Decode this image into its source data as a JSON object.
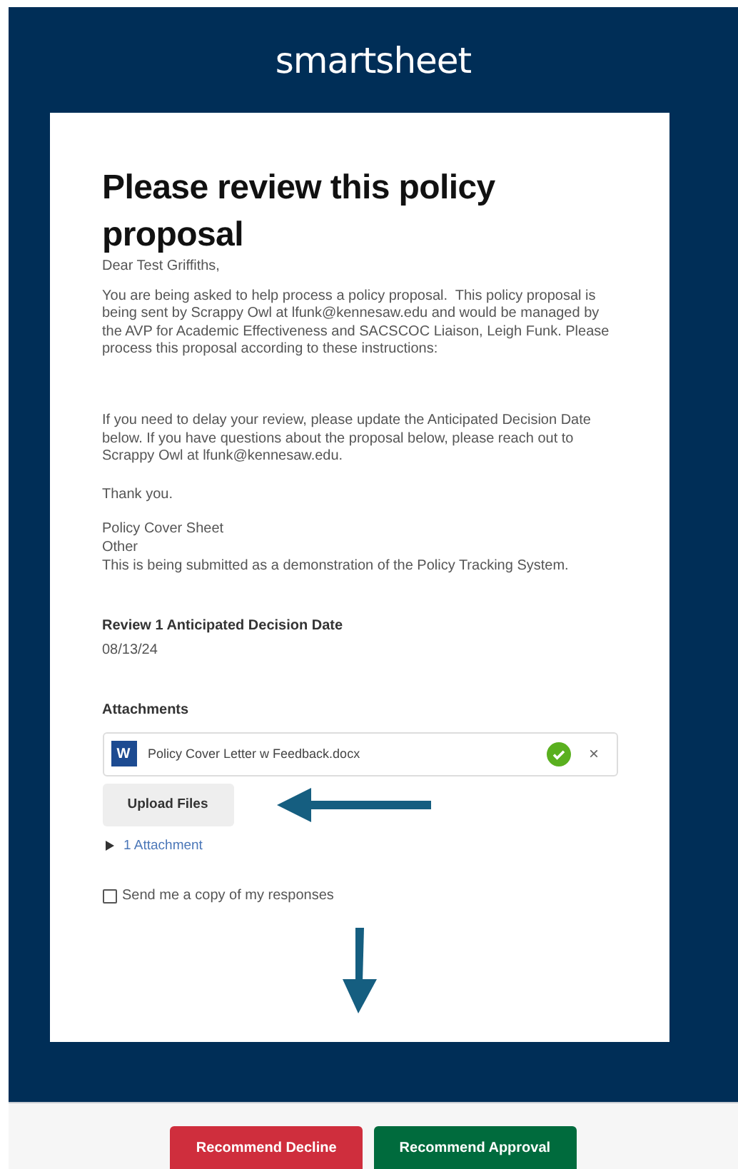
{
  "logo": "smartsheet",
  "title": "Please review this policy proposal",
  "greeting": "Dear Test Griffiths,",
  "paragraphs": [
    {
      "lines": [
        "You are being asked to help process a policy proposal.  This policy proposal is being sent by Scrappy Owl at lfunk@kennesaw.edu and would be managed by the AVP for Academic Effectiveness and SACSCOC Liaison, Leigh Funk. Please process this proposal according to these instructions:"
      ]
    },
    {
      "lines": [
        "If you need to delay your review, please update the Anticipated Decision Date below. If you have questions about the proposal below, please reach out to Scrappy Owl at lfunk@kennesaw.edu."
      ]
    },
    {
      "lines": [
        "Thank you."
      ]
    },
    {
      "lines": [
        "Policy Cover Sheet",
        "Other",
        "This is being submitted as a demonstration of the Policy Tracking System."
      ]
    }
  ],
  "field": {
    "label": "Review 1 Anticipated Decision Date",
    "value": "08/13/24"
  },
  "attachments": {
    "label": "Attachments",
    "files": [
      {
        "badge": "W",
        "name": "Policy Cover Letter w Feedback.docx",
        "uploaded": true,
        "remove": "×"
      }
    ],
    "upload_button": "Upload Files",
    "toggle": {
      "label": "1 Attachment",
      "expanded": false
    }
  },
  "copy_checkbox": {
    "label": "Send me a copy of my responses",
    "checked": false
  },
  "buttons": [
    {
      "label": "Recommend Decline",
      "kind": "decline"
    },
    {
      "label": "Recommend Approval",
      "kind": "approve"
    }
  ]
}
